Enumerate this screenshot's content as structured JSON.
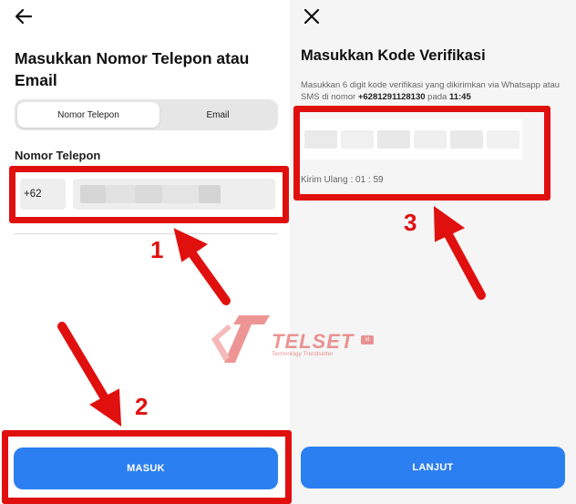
{
  "left_screen": {
    "title": "Masukkan Nomor Telepon atau Email",
    "tabs": [
      {
        "label": "Nomor Telepon",
        "active": true
      },
      {
        "label": "Email",
        "active": false
      }
    ],
    "phone_label": "Nomor Telepon",
    "country_code": "+62",
    "submit_label": "MASUK"
  },
  "right_screen": {
    "title": "Masukkan Kode Verifikasi",
    "desc_prefix": "Masukkan 6 digit kode verifikasi yang dikirimkan via Whatsapp atau SMS di nomor ",
    "phone_number": "+6281291128130",
    "desc_middle": " pada ",
    "time": "11:45",
    "resend": "Kirim Ulang : 01 : 59",
    "submit_label": "LANJUT"
  },
  "annotations": {
    "step1": "1",
    "step2": "2",
    "step3": "3",
    "color": "#e0100f"
  },
  "watermark": {
    "brand": "TELSET",
    "badge": "id",
    "tagline": "Technology Trendsetter"
  },
  "colors": {
    "primary_button": "#2c7ff0",
    "right_background": "#f5f5f5"
  }
}
